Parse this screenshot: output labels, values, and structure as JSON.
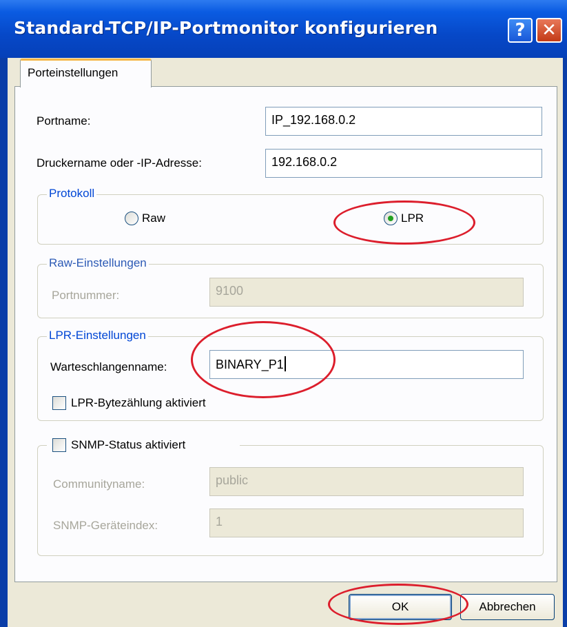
{
  "window": {
    "title": "Standard-TCP/IP-Portmonitor konfigurieren",
    "help_glyph": "?",
    "close_glyph": "✕"
  },
  "tabs": [
    {
      "label": "Porteinstellungen",
      "selected": true
    }
  ],
  "port": {
    "portname_label": "Portname:",
    "portname_value": "IP_192.168.0.2",
    "address_label": "Druckername oder -IP-Adresse:",
    "address_value": "192.168.0.2"
  },
  "protocol": {
    "title": "Protokoll",
    "raw_label": "Raw",
    "lpr_label": "LPR",
    "selected": "LPR"
  },
  "raw_settings": {
    "title": "Raw-Einstellungen",
    "portnumber_label": "Portnummer:",
    "portnumber_value": "9100",
    "enabled": false
  },
  "lpr_settings": {
    "title": "LPR-Einstellungen",
    "queue_label": "Warteschlangenname:",
    "queue_value": "BINARY_P1",
    "bytecount_label": "LPR-Bytezählung aktiviert",
    "bytecount_checked": false
  },
  "snmp": {
    "status_label": "SNMP-Status aktiviert",
    "status_checked": false,
    "community_label": "Communityname:",
    "community_value": "public",
    "index_label": "SNMP-Geräteindex:",
    "index_value": "1",
    "enabled": false
  },
  "buttons": {
    "ok": "OK",
    "cancel": "Abbrechen"
  },
  "colors": {
    "titlebar": "#0b5ce2",
    "dialog_background": "#ece9d8",
    "group_title": "#0046d5",
    "annotation": "#dc1e2c",
    "radio_selected": "#21a121"
  }
}
